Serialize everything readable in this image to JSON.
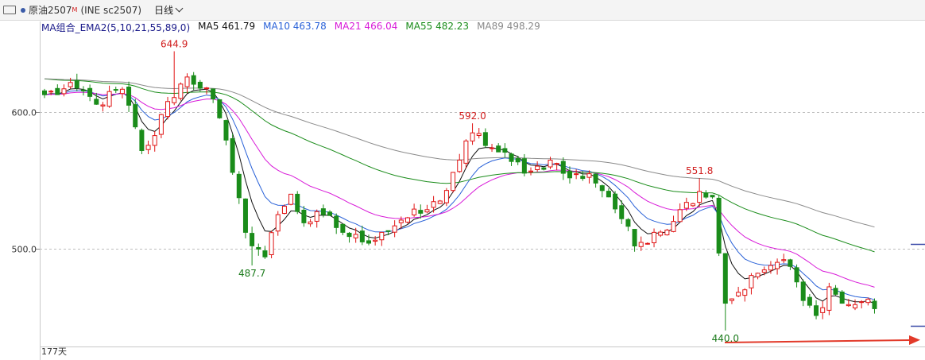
{
  "header": {
    "symbol": "原油2507",
    "badge": "M",
    "code": "(INE sc2507)",
    "period": "日线"
  },
  "legend": {
    "group": "MA组合_EMA2(5,10,21,55,89,0)",
    "items": [
      {
        "label": "MA5 461.79",
        "color": "#111111"
      },
      {
        "label": "MA10 463.78",
        "color": "#2a62d8"
      },
      {
        "label": "MA21 466.04",
        "color": "#d81ad8"
      },
      {
        "label": "MA55 482.23",
        "color": "#1a8c1a"
      },
      {
        "label": "MA89 498.29",
        "color": "#8a8a8a"
      }
    ]
  },
  "footer": {
    "days": "177天"
  },
  "chart_data": {
    "type": "candlestick",
    "ylim": [
      430,
      665
    ],
    "y_ticks": [
      500.0,
      600.0
    ],
    "y_tick_labels": [
      "500.0",
      "600.0"
    ],
    "grid": true,
    "annotations": [
      {
        "label": "644.9",
        "index": 20,
        "value": 644.9,
        "color": "#d01c1c",
        "pos": "above"
      },
      {
        "label": "487.7",
        "index": 32,
        "value": 487.7,
        "color": "#1a7a1a",
        "pos": "below"
      },
      {
        "label": "592.0",
        "index": 66,
        "value": 592.0,
        "color": "#d01c1c",
        "pos": "above"
      },
      {
        "label": "551.8",
        "index": 101,
        "value": 551.8,
        "color": "#d01c1c",
        "pos": "above"
      },
      {
        "label": "440.0",
        "index": 105,
        "value": 440.0,
        "color": "#1a7a1a",
        "pos": "below"
      }
    ],
    "anchors": [
      [
        0,
        613
      ],
      [
        5,
        618
      ],
      [
        8,
        606
      ],
      [
        12,
        617
      ],
      [
        15,
        572
      ],
      [
        17,
        583
      ],
      [
        19,
        608
      ],
      [
        22,
        626
      ],
      [
        25,
        618
      ],
      [
        27,
        596
      ],
      [
        29,
        556
      ],
      [
        31,
        512
      ],
      [
        34,
        494
      ],
      [
        36,
        525
      ],
      [
        38,
        540
      ],
      [
        40,
        519
      ],
      [
        43,
        525
      ],
      [
        46,
        512
      ],
      [
        49,
        505
      ],
      [
        52,
        512
      ],
      [
        55,
        521
      ],
      [
        58,
        526
      ],
      [
        61,
        535
      ],
      [
        63,
        556
      ],
      [
        66,
        585
      ],
      [
        69,
        574
      ],
      [
        72,
        564
      ],
      [
        75,
        557
      ],
      [
        78,
        565
      ],
      [
        81,
        552
      ],
      [
        84,
        555
      ],
      [
        87,
        538
      ],
      [
        89,
        522
      ],
      [
        91,
        502
      ],
      [
        94,
        512
      ],
      [
        97,
        520
      ],
      [
        99,
        534
      ],
      [
        101,
        542
      ],
      [
        103,
        538
      ],
      [
        105,
        460
      ],
      [
        107,
        468
      ],
      [
        110,
        482
      ],
      [
        113,
        490
      ],
      [
        115,
        487
      ],
      [
        117,
        462
      ],
      [
        119,
        451
      ],
      [
        121,
        472
      ],
      [
        123,
        460
      ],
      [
        125,
        459
      ],
      [
        127,
        463
      ],
      [
        128,
        456
      ]
    ]
  }
}
